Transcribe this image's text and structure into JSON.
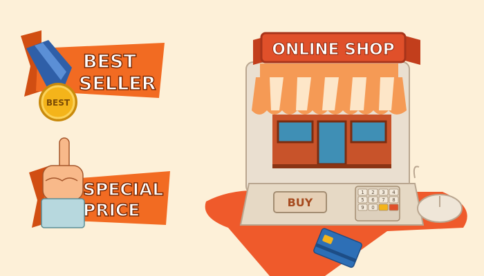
{
  "best_seller": {
    "line1": "BEST",
    "line2": "SELLER",
    "medal_text": "BEST"
  },
  "special_price": {
    "line1": "SPECIAL",
    "line2": "PRICE"
  },
  "shop": {
    "sign_text": "ONLINE SHOP",
    "buy_key_label": "BUY"
  },
  "keypad": {
    "keys": [
      "1",
      "2",
      "3",
      "4",
      "5",
      "6",
      "7",
      "8",
      "9",
      "0",
      "",
      ""
    ]
  },
  "colors": {
    "background": "#fdf0d8",
    "banner_orange": "#f26b22",
    "banner_dark": "#d14e12",
    "sign_red": "#e0502a",
    "awning_stripe": "#f59a55",
    "store_wall": "#c8532a",
    "window_blue": "#3f8fb5",
    "card_blue": "#2d6fb6",
    "medal_gold": "#f4b41a",
    "ribbon_blue": "#2f5fa8"
  }
}
